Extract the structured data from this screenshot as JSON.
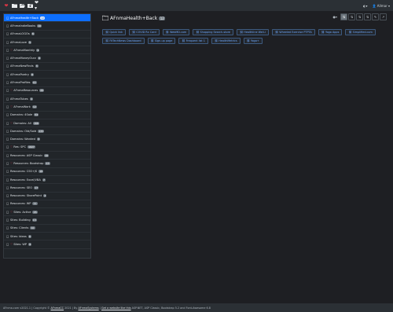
{
  "navbar": {
    "user_label": "Allmar",
    "icons": [
      "heart-icon",
      "folder-icon",
      "folder-open-icon",
      "folder-plus-icon",
      "heart-dropdown-icon",
      "theme-icon",
      "user-icon"
    ]
  },
  "sidebar": {
    "items": [
      {
        "label": "AFnmaHealth+Back",
        "count": "12",
        "active": true,
        "heart": false
      },
      {
        "label": "AFnmaIndieBooks",
        "count": "10",
        "active": false,
        "heart": false
      },
      {
        "label": "AFnmaLOGOs",
        "count": "8",
        "active": false,
        "heart": false
      },
      {
        "label": "AFnmaLove",
        "count": "5",
        "active": false,
        "heart": false
      },
      {
        "label": "AFnmaMonthly",
        "count": "4",
        "active": false,
        "heart": true
      },
      {
        "label": "AFnmaMoneyOurz",
        "count": "6",
        "active": false,
        "heart": false
      },
      {
        "label": "AFnmaNewFinds",
        "count": "3",
        "active": false,
        "heart": false
      },
      {
        "label": "AFnmaPoetry",
        "count": "8",
        "active": false,
        "heart": false
      },
      {
        "label": "AFnmaProfiles",
        "count": "14",
        "active": false,
        "heart": false
      },
      {
        "label": "AFnmaResources",
        "count": "26",
        "active": false,
        "heart": true
      },
      {
        "label": "AFnmaTubes",
        "count": "4",
        "active": false,
        "heart": false
      },
      {
        "label": "AFnmaWork",
        "count": "12",
        "active": false,
        "heart": true
      },
      {
        "label": "Domains: 4Sale",
        "count": "54",
        "active": false,
        "heart": false
      },
      {
        "label": "Domains: All",
        "count": "168",
        "active": false,
        "heart": true
      },
      {
        "label": "Domains: Old/Sold",
        "count": "133",
        "active": false,
        "heart": false
      },
      {
        "label": "Domains: Wanted",
        "count": "3",
        "active": false,
        "heart": false
      },
      {
        "label": "Res: SPC",
        "count": "1627",
        "active": false,
        "heart": true
      },
      {
        "label": "Resources: ASP Classic",
        "count": "26",
        "active": false,
        "heart": false
      },
      {
        "label": "Resources: Bootstrap",
        "count": "43",
        "active": false,
        "heart": true
      },
      {
        "label": "Resources: CSS+JS",
        "count": "18",
        "active": false,
        "heart": false
      },
      {
        "label": "Resources: Excel/VBA",
        "count": "7",
        "active": false,
        "heart": false
      },
      {
        "label": "Resources: SEO",
        "count": "17",
        "active": false,
        "heart": false
      },
      {
        "label": "Resources: SharePoint",
        "count": "4",
        "active": false,
        "heart": false
      },
      {
        "label": "Resources: WP",
        "count": "11",
        "active": false,
        "heart": false
      },
      {
        "label": "Sites: Active",
        "count": "26",
        "active": false,
        "heart": true
      },
      {
        "label": "Sites: Building",
        "count": "13",
        "active": false,
        "heart": false
      },
      {
        "label": "Sites: Clients",
        "count": "10",
        "active": false,
        "heart": false
      },
      {
        "label": "Sites: Ideas",
        "count": "6",
        "active": false,
        "heart": false
      },
      {
        "label": "Sites: WP",
        "count": "8",
        "active": false,
        "heart": true
      }
    ]
  },
  "main": {
    "folder_name": "AFnmaHealth+Back",
    "folder_count": "12",
    "toolbar": [
      "sort-az-icon",
      "sort-za-icon",
      "sort-date-icon",
      "sort-date-desc-icon",
      "edit-icon",
      "external-icon"
    ],
    "links": [
      "Quick link",
      "COVID Rx Card",
      "WebMD.com",
      "Shopping Search-store",
      "Healthline Well-i",
      "Wheeled Exercise PTPTA",
      "Yoga Apps",
      "Simplified.com",
      "FitTechNews Dashboard",
      "Sign-up page",
      "Frequent list 1",
      "HealthMetrics",
      "Yoga+"
    ]
  },
  "footer": {
    "app_name": "AFnma.com",
    "version": "v2021.1",
    "copyright": "| Copyright ©",
    "author": "AFnmaCC",
    "year": "2021 | By",
    "company": "AFnmaSystems",
    "sep": "|",
    "cta": "Get a website like this",
    "tech": "ASP.NET, ASP Classic, Bootstrap 5.2 and Font-Awesome 6.8"
  },
  "colors": {
    "accent": "#0d6efd",
    "heart": "#dc3545",
    "link": "#6ea8fe"
  }
}
